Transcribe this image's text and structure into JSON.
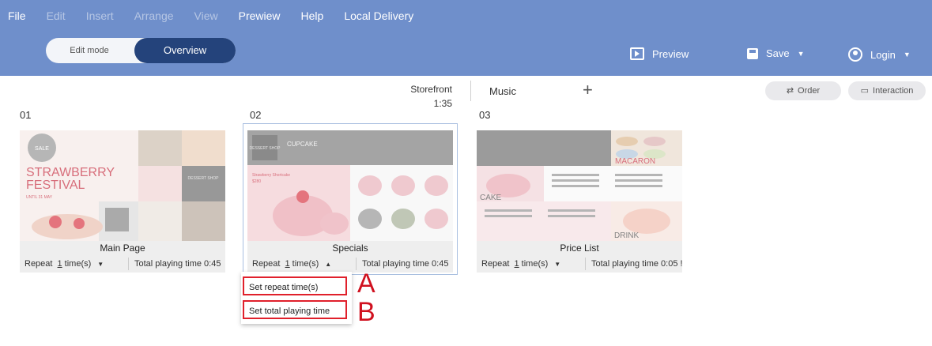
{
  "menu": {
    "items": [
      {
        "label": "File",
        "enabled": true
      },
      {
        "label": "Edit",
        "enabled": false
      },
      {
        "label": "Insert",
        "enabled": false
      },
      {
        "label": "Arrange",
        "enabled": false
      },
      {
        "label": "View",
        "enabled": false
      },
      {
        "label": "Prewiew",
        "enabled": true
      },
      {
        "label": "Help",
        "enabled": true
      },
      {
        "label": "Local Delivery",
        "enabled": true
      }
    ]
  },
  "mode": {
    "edit_label": "Edit mode",
    "overview_label": "Overview",
    "active": "Overview"
  },
  "toolbar": {
    "preview_label": "Preview",
    "preview_icon": "play-box-icon",
    "save_label": "Save",
    "save_icon": "save-icon",
    "login_label": "Login",
    "login_icon": "user-circle-icon"
  },
  "playlist": {
    "name": "Storefront",
    "duration": "1:35",
    "music_label": "Music",
    "add_icon": "plus-icon",
    "order_label": "Order",
    "interaction_label": "Interaction"
  },
  "slides": [
    {
      "number": "01",
      "title": "Main Page",
      "repeat_prefix": "Repeat",
      "repeat_count": "1",
      "repeat_suffix": "time(s)",
      "total": "Total playing time 0:45",
      "selected": false,
      "thumb": {
        "headline1": "STRAWBERRY",
        "headline2": "FESTIVAL",
        "subline": "UNTIL 31 MAY",
        "badge": "SALE",
        "sign": "DESSERT SHOP"
      }
    },
    {
      "number": "02",
      "title": "Specials",
      "repeat_prefix": "Repeat",
      "repeat_count": "1",
      "repeat_suffix": "time(s)",
      "total": "Total playing time 0:45",
      "selected": true,
      "thumb": {
        "banner": "CUPCAKE",
        "item": "Strawberry Shortcake",
        "price": "$280",
        "sign": "DESSERT SHOP"
      }
    },
    {
      "number": "03",
      "title": "Price List",
      "repeat_prefix": "Repeat",
      "repeat_count": "1",
      "repeat_suffix": "time(s)",
      "total": "Total playing time 0:05 !",
      "selected": false,
      "thumb": {
        "label1": "MACARON",
        "label2": "CAKE",
        "label3": "DRINK"
      }
    }
  ],
  "popup": {
    "item_a": "Set repeat time(s)",
    "item_b": "Set total playing time"
  },
  "callouts": {
    "a": "A",
    "b": "B"
  },
  "colors": {
    "topbar": "#6f8fcb",
    "overview_active": "#24437b",
    "callout_red": "#d0111f",
    "card_footer": "#eeeeee"
  }
}
